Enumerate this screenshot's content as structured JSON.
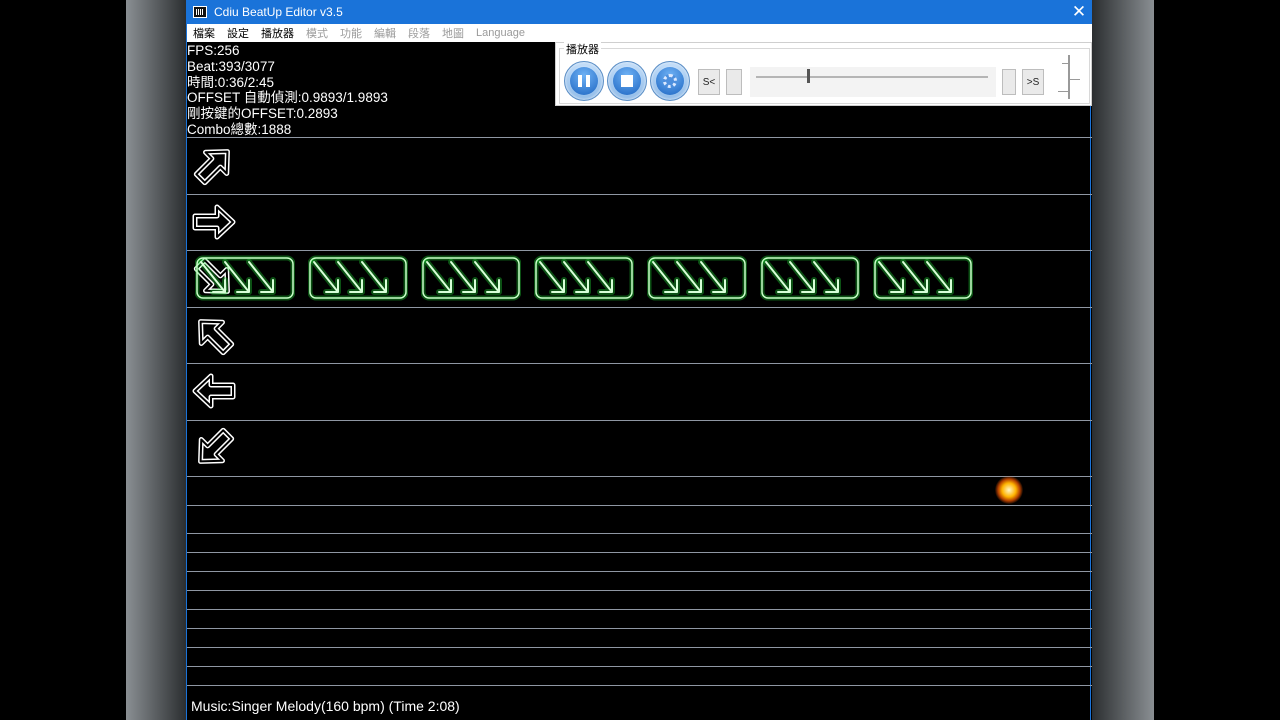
{
  "window": {
    "title": "Cdiu BeatUp Editor v3.5",
    "close_glyph": "✕"
  },
  "menu": {
    "items": [
      {
        "label": "檔案",
        "enabled": true
      },
      {
        "label": "設定",
        "enabled": true
      },
      {
        "label": "播放器",
        "enabled": true
      },
      {
        "label": "模式",
        "enabled": false
      },
      {
        "label": "功能",
        "enabled": false
      },
      {
        "label": "編輯",
        "enabled": false
      },
      {
        "label": "段落",
        "enabled": false
      },
      {
        "label": "地圖",
        "enabled": false
      },
      {
        "label": "Language",
        "enabled": false
      }
    ]
  },
  "stats": {
    "fps": "FPS:256",
    "beat": "Beat:393/3077",
    "time": "時間:0:36/2:45",
    "offset_auto": "OFFSET 自動偵測:0.9893/1.9893",
    "offset_last": "剛按鍵的OFFSET:0.2893",
    "combo": "Combo總數:1888"
  },
  "player": {
    "legend": "播放器",
    "start_label": "S<",
    "end_label": ">S",
    "progress": 0.22
  },
  "lanes": {
    "directions": [
      "up-right",
      "right",
      "down-right",
      "up-left",
      "left",
      "down-left"
    ],
    "active_lane": "down-right",
    "note_count": 7,
    "note_color": "#22e83a"
  },
  "colors": {
    "title_bar": "#1a73d9",
    "lane_line": "#8f97a3",
    "note_glow": "#22e83a",
    "spark": "#ffb300"
  },
  "footer": {
    "music": "Music:Singer Melody(160 bpm) (Time 2:08)"
  }
}
